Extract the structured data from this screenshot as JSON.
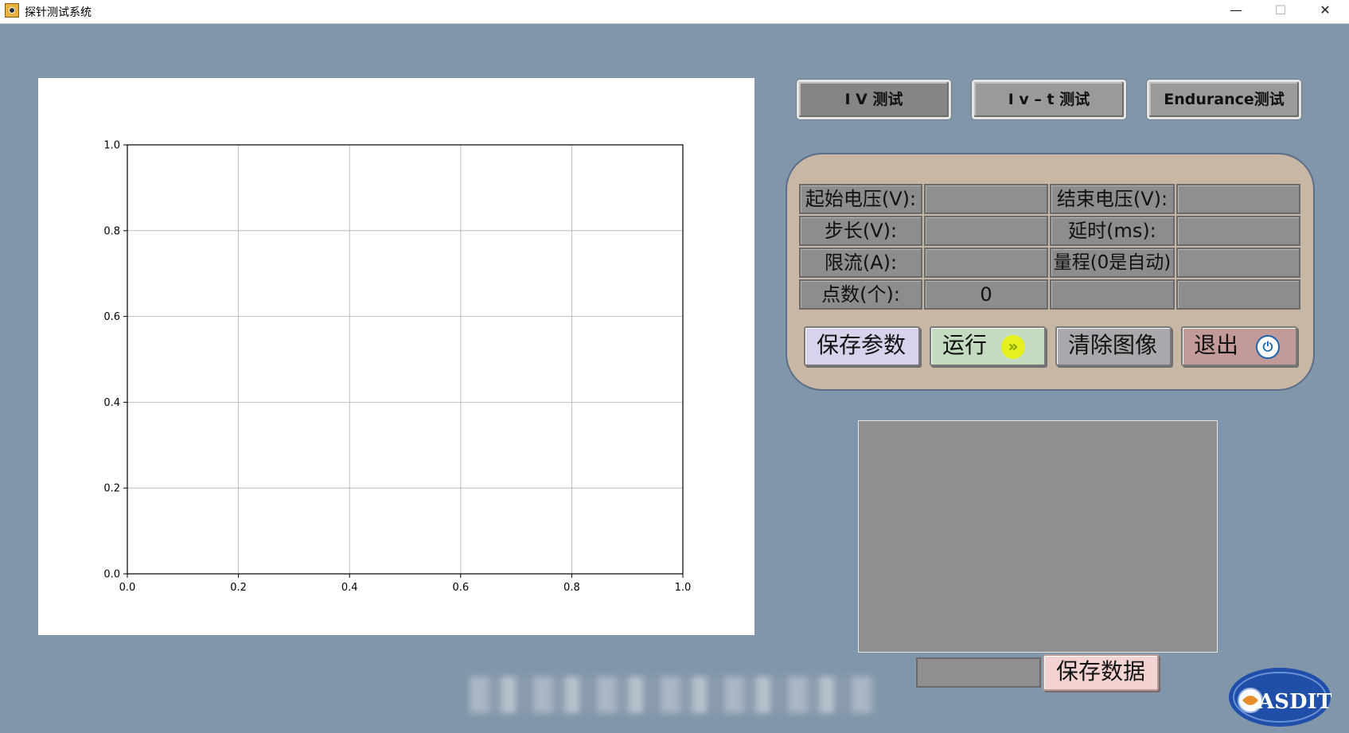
{
  "window": {
    "title": "探针测试系统",
    "controls": {
      "minimize": "—",
      "maximize": "☐",
      "close": "✕"
    }
  },
  "chart_data": {
    "type": "line",
    "series": [],
    "xlim": [
      0.0,
      1.0
    ],
    "ylim": [
      0.0,
      1.0
    ],
    "xticks": [
      "0.0",
      "0.2",
      "0.4",
      "0.6",
      "0.8",
      "1.0"
    ],
    "yticks": [
      "0.0",
      "0.2",
      "0.4",
      "0.6",
      "0.8",
      "1.0"
    ],
    "grid": true,
    "title": "",
    "xlabel": "",
    "ylabel": ""
  },
  "mode_tabs": [
    {
      "label": "I V 测试"
    },
    {
      "label": "I v – t 测试"
    },
    {
      "label": "Endurance测试"
    }
  ],
  "params": {
    "start_voltage_label": "起始电压(V):",
    "start_voltage_value": "",
    "end_voltage_label": "结束电压(V):",
    "end_voltage_value": "",
    "step_label": "步长(V):",
    "step_value": "",
    "delay_label": "延时(ms):",
    "delay_value": "",
    "current_limit_label": "限流(A):",
    "current_limit_value": "",
    "range_label": "量程(0是自动)",
    "range_value": "",
    "points_label": "点数(个):",
    "points_value": "0"
  },
  "actions": {
    "save_params": "保存参数",
    "run": "运行",
    "clear_plot": "清除图像",
    "exit": "退出"
  },
  "save_data": {
    "filename": "",
    "button": "保存数据"
  },
  "logo": {
    "text": "ASDIT"
  },
  "colors": {
    "background": "#8196ab",
    "save_params_button": "#d8d2ec",
    "run_button": "#c3dcc0",
    "run_icon": "#e5f01e",
    "clear_button": "#a9a9ad",
    "exit_button": "#c39a9a",
    "save_data_button": "#f3d2d2"
  }
}
